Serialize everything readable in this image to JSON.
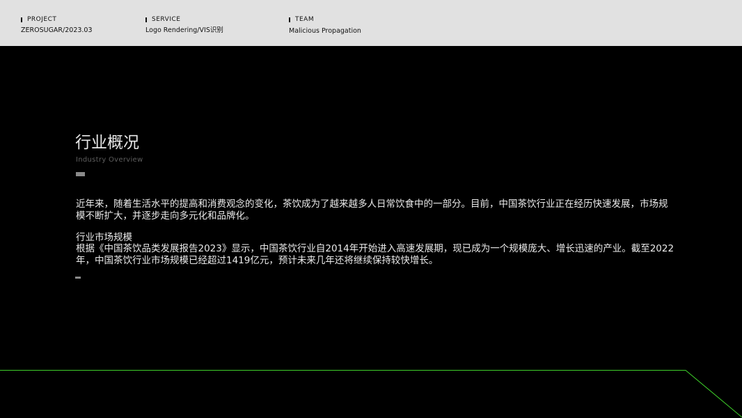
{
  "header": {
    "project": {
      "label": "PROJECT",
      "value": "ZEROSUGAR/2023.03"
    },
    "service": {
      "label": "SERVICE",
      "value": "Logo Rendering/VIS识别"
    },
    "team": {
      "label": "TEAM",
      "value": "Malicious Propagation"
    }
  },
  "section": {
    "title": "行业概况",
    "subtitle": "Industry Overview",
    "paragraph1": "近年来，随着生活水平的提高和消费观念的变化，茶饮成为了越来越多人日常饮食中的一部分。目前，中国茶饮行业正在经历快速发展，市场规模不断扩大，并逐步走向多元化和品牌化。",
    "market_title": "行业市场规模",
    "paragraph2": "根据《中国茶饮品类发展报告2023》显示，中国茶饮行业自2014年开始进入高速发展期，现已成为一个规模庞大、增长迅速的产业。截至2022年，中国茶饮行业市场规模已经超过1419亿元，预计未来几年还将继续保持较快增长。"
  },
  "colors": {
    "background": "#000000",
    "topbar": "#e1e1e1",
    "accent_line": "#3ecf2a"
  }
}
